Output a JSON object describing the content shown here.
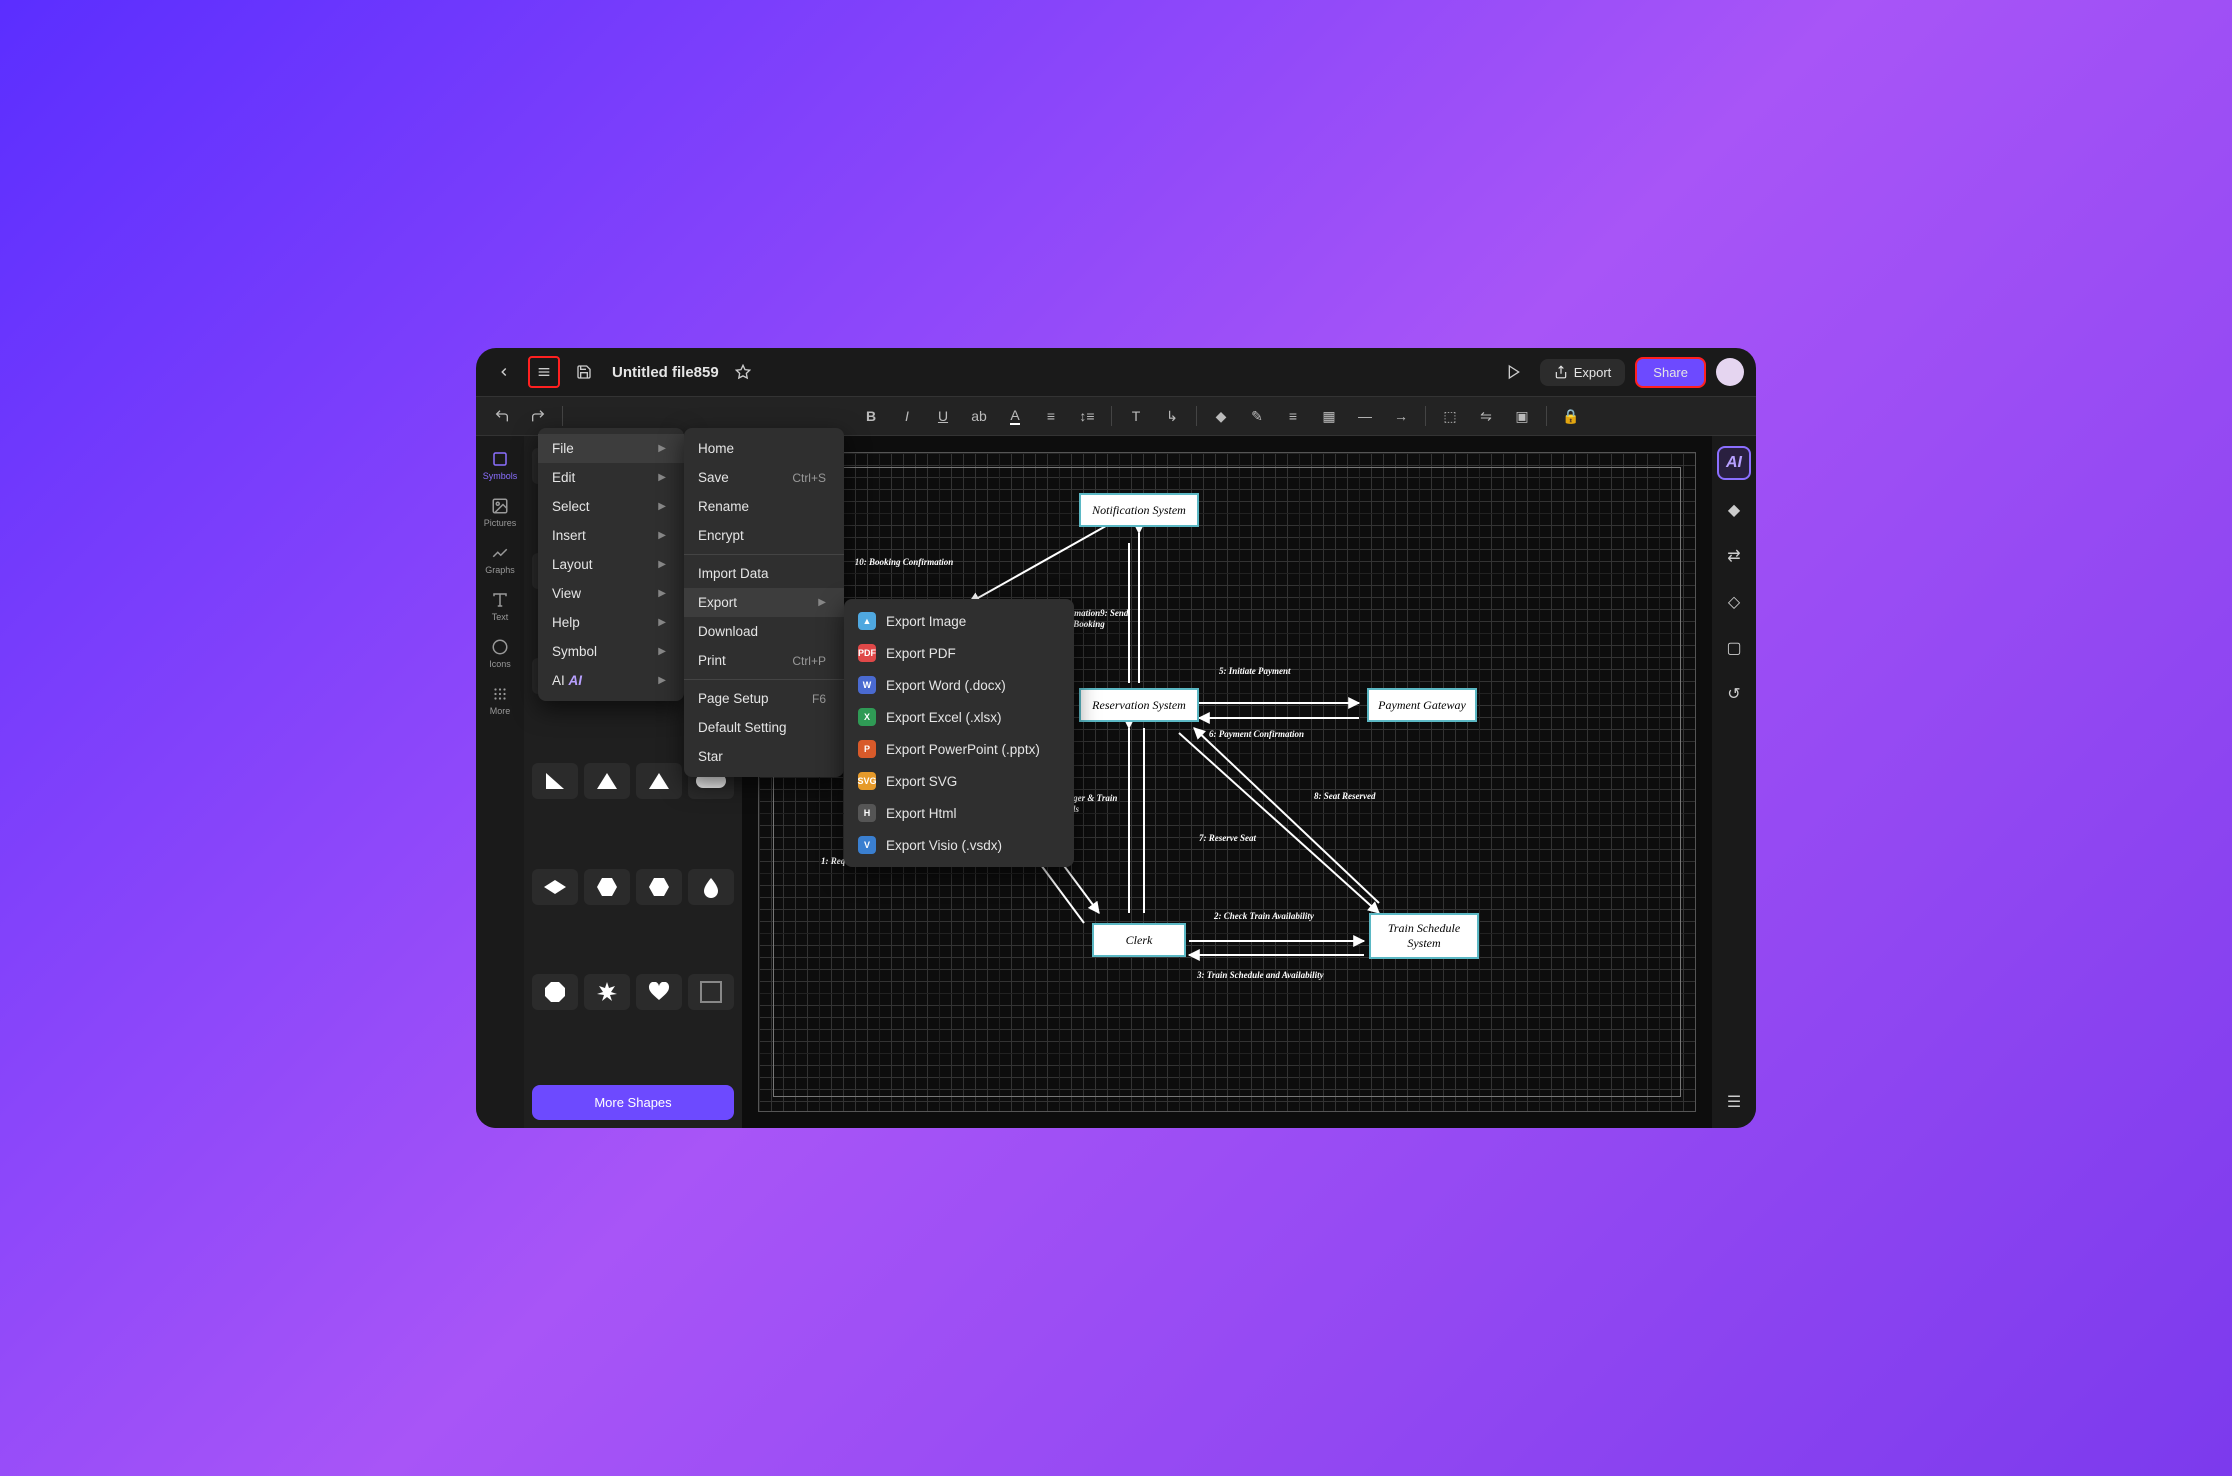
{
  "titlebar": {
    "filename": "Untitled file859",
    "export_label": "Export",
    "share_label": "Share"
  },
  "left_rail": {
    "symbols": "Symbols",
    "pictures": "Pictures",
    "graphs": "Graphs",
    "text": "Text",
    "icons": "Icons",
    "more": "More"
  },
  "shapes_panel": {
    "more_shapes": "More Shapes"
  },
  "main_menu": {
    "file": "File",
    "edit": "Edit",
    "select": "Select",
    "insert": "Insert",
    "layout": "Layout",
    "view": "View",
    "help": "Help",
    "symbol": "Symbol",
    "ai": "AI"
  },
  "file_menu": {
    "home": "Home",
    "save": "Save",
    "save_shortcut": "Ctrl+S",
    "rename": "Rename",
    "encrypt": "Encrypt",
    "import_data": "Import Data",
    "export": "Export",
    "download": "Download",
    "print": "Print",
    "print_shortcut": "Ctrl+P",
    "page_setup": "Page Setup",
    "page_setup_shortcut": "F6",
    "default_setting": "Default Setting",
    "star": "Star"
  },
  "export_menu": {
    "image": "Export Image",
    "pdf": "Export PDF",
    "word": "Export Word (.docx)",
    "excel": "Export Excel (.xlsx)",
    "ppt": "Export PowerPoint (.pptx)",
    "svg": "Export SVG",
    "html": "Export Html",
    "visio": "Export Visio (.vsdx)"
  },
  "diagram": {
    "notification": "Notification System",
    "reservation": "Reservation System",
    "payment": "Payment Gateway",
    "clerk": "Clerk",
    "train": "Train Schedule System",
    "l10": "10: Booking Confirmation",
    "l9": "Confirmation9: Send Booking",
    "l5": "5: Initiate Payment",
    "l6": "6: Payment Confirmation",
    "l4": "4: Input Passenger & Train Details",
    "l7": "7: Reserve Seat",
    "l8": "8: Seat Reserved",
    "l1": "1: Request Ticket Booking",
    "l2": "2: Check Train Availability",
    "l3": "3: Train Schedule and Availability"
  }
}
